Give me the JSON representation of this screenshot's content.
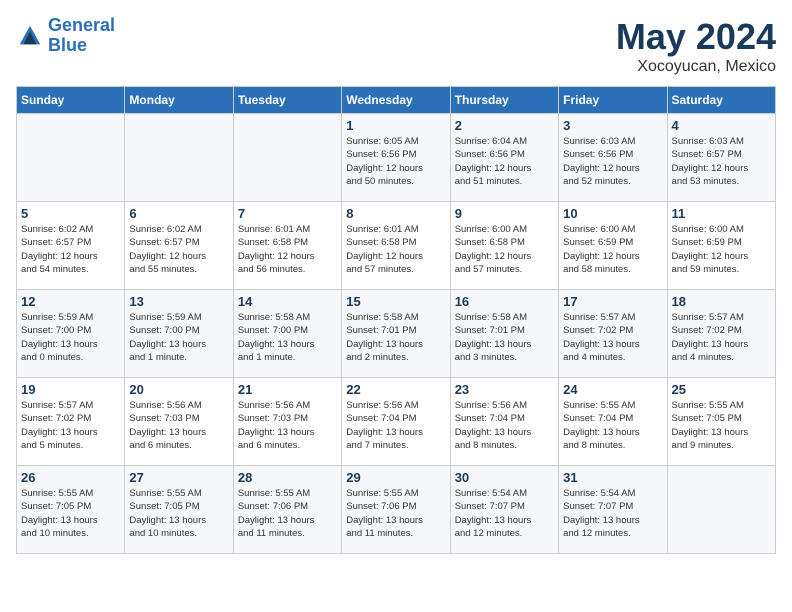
{
  "header": {
    "logo_line1": "General",
    "logo_line2": "Blue",
    "month": "May 2024",
    "location": "Xocoyucan, Mexico"
  },
  "weekdays": [
    "Sunday",
    "Monday",
    "Tuesday",
    "Wednesday",
    "Thursday",
    "Friday",
    "Saturday"
  ],
  "weeks": [
    [
      {
        "day": "",
        "text": ""
      },
      {
        "day": "",
        "text": ""
      },
      {
        "day": "",
        "text": ""
      },
      {
        "day": "1",
        "text": "Sunrise: 6:05 AM\nSunset: 6:56 PM\nDaylight: 12 hours\nand 50 minutes."
      },
      {
        "day": "2",
        "text": "Sunrise: 6:04 AM\nSunset: 6:56 PM\nDaylight: 12 hours\nand 51 minutes."
      },
      {
        "day": "3",
        "text": "Sunrise: 6:03 AM\nSunset: 6:56 PM\nDaylight: 12 hours\nand 52 minutes."
      },
      {
        "day": "4",
        "text": "Sunrise: 6:03 AM\nSunset: 6:57 PM\nDaylight: 12 hours\nand 53 minutes."
      }
    ],
    [
      {
        "day": "5",
        "text": "Sunrise: 6:02 AM\nSunset: 6:57 PM\nDaylight: 12 hours\nand 54 minutes."
      },
      {
        "day": "6",
        "text": "Sunrise: 6:02 AM\nSunset: 6:57 PM\nDaylight: 12 hours\nand 55 minutes."
      },
      {
        "day": "7",
        "text": "Sunrise: 6:01 AM\nSunset: 6:58 PM\nDaylight: 12 hours\nand 56 minutes."
      },
      {
        "day": "8",
        "text": "Sunrise: 6:01 AM\nSunset: 6:58 PM\nDaylight: 12 hours\nand 57 minutes."
      },
      {
        "day": "9",
        "text": "Sunrise: 6:00 AM\nSunset: 6:58 PM\nDaylight: 12 hours\nand 57 minutes."
      },
      {
        "day": "10",
        "text": "Sunrise: 6:00 AM\nSunset: 6:59 PM\nDaylight: 12 hours\nand 58 minutes."
      },
      {
        "day": "11",
        "text": "Sunrise: 6:00 AM\nSunset: 6:59 PM\nDaylight: 12 hours\nand 59 minutes."
      }
    ],
    [
      {
        "day": "12",
        "text": "Sunrise: 5:59 AM\nSunset: 7:00 PM\nDaylight: 13 hours\nand 0 minutes."
      },
      {
        "day": "13",
        "text": "Sunrise: 5:59 AM\nSunset: 7:00 PM\nDaylight: 13 hours\nand 1 minute."
      },
      {
        "day": "14",
        "text": "Sunrise: 5:58 AM\nSunset: 7:00 PM\nDaylight: 13 hours\nand 1 minute."
      },
      {
        "day": "15",
        "text": "Sunrise: 5:58 AM\nSunset: 7:01 PM\nDaylight: 13 hours\nand 2 minutes."
      },
      {
        "day": "16",
        "text": "Sunrise: 5:58 AM\nSunset: 7:01 PM\nDaylight: 13 hours\nand 3 minutes."
      },
      {
        "day": "17",
        "text": "Sunrise: 5:57 AM\nSunset: 7:02 PM\nDaylight: 13 hours\nand 4 minutes."
      },
      {
        "day": "18",
        "text": "Sunrise: 5:57 AM\nSunset: 7:02 PM\nDaylight: 13 hours\nand 4 minutes."
      }
    ],
    [
      {
        "day": "19",
        "text": "Sunrise: 5:57 AM\nSunset: 7:02 PM\nDaylight: 13 hours\nand 5 minutes."
      },
      {
        "day": "20",
        "text": "Sunrise: 5:56 AM\nSunset: 7:03 PM\nDaylight: 13 hours\nand 6 minutes."
      },
      {
        "day": "21",
        "text": "Sunrise: 5:56 AM\nSunset: 7:03 PM\nDaylight: 13 hours\nand 6 minutes."
      },
      {
        "day": "22",
        "text": "Sunrise: 5:56 AM\nSunset: 7:04 PM\nDaylight: 13 hours\nand 7 minutes."
      },
      {
        "day": "23",
        "text": "Sunrise: 5:56 AM\nSunset: 7:04 PM\nDaylight: 13 hours\nand 8 minutes."
      },
      {
        "day": "24",
        "text": "Sunrise: 5:55 AM\nSunset: 7:04 PM\nDaylight: 13 hours\nand 8 minutes."
      },
      {
        "day": "25",
        "text": "Sunrise: 5:55 AM\nSunset: 7:05 PM\nDaylight: 13 hours\nand 9 minutes."
      }
    ],
    [
      {
        "day": "26",
        "text": "Sunrise: 5:55 AM\nSunset: 7:05 PM\nDaylight: 13 hours\nand 10 minutes."
      },
      {
        "day": "27",
        "text": "Sunrise: 5:55 AM\nSunset: 7:05 PM\nDaylight: 13 hours\nand 10 minutes."
      },
      {
        "day": "28",
        "text": "Sunrise: 5:55 AM\nSunset: 7:06 PM\nDaylight: 13 hours\nand 11 minutes."
      },
      {
        "day": "29",
        "text": "Sunrise: 5:55 AM\nSunset: 7:06 PM\nDaylight: 13 hours\nand 11 minutes."
      },
      {
        "day": "30",
        "text": "Sunrise: 5:54 AM\nSunset: 7:07 PM\nDaylight: 13 hours\nand 12 minutes."
      },
      {
        "day": "31",
        "text": "Sunrise: 5:54 AM\nSunset: 7:07 PM\nDaylight: 13 hours\nand 12 minutes."
      },
      {
        "day": "",
        "text": ""
      }
    ]
  ]
}
